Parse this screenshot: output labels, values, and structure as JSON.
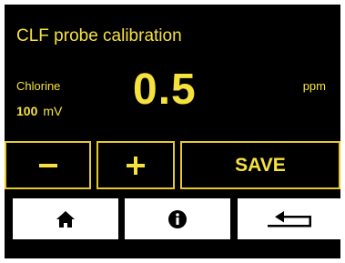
{
  "screen": {
    "title": "CLF probe calibration",
    "parameter_label": "Chlorine",
    "mv_value": "100",
    "mv_unit": "mV",
    "reading_value": "0.5",
    "reading_unit": "ppm"
  },
  "controls": {
    "decrease_icon": "minus-icon",
    "increase_icon": "plus-icon",
    "save_label": "SAVE"
  },
  "nav": {
    "home_icon": "home-icon",
    "info_icon": "info-icon",
    "back_icon": "return-arrow-icon"
  },
  "colors": {
    "accent": "#f5e23c",
    "border": "#e6c82a",
    "background": "#000000",
    "nav_background": "#ffffff"
  }
}
